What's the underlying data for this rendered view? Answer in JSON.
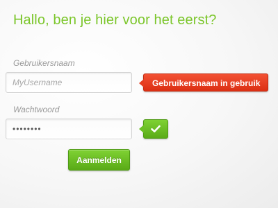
{
  "colors": {
    "heading": "#7bc62a",
    "label": "#9a9a9a",
    "error": "#e33a1b",
    "success": "#6cc024"
  },
  "heading": "Hallo, ben je hier voor het eerst?",
  "form": {
    "username": {
      "label": "Gebruikersnaam",
      "placeholder": "MyUsername",
      "value": "",
      "error_message": "Gebruikersnaam in gebruik"
    },
    "password": {
      "label": "Wachtwoord",
      "value": "********",
      "status_icon": "checkmark-icon"
    },
    "submit_label": "Aanmelden"
  }
}
